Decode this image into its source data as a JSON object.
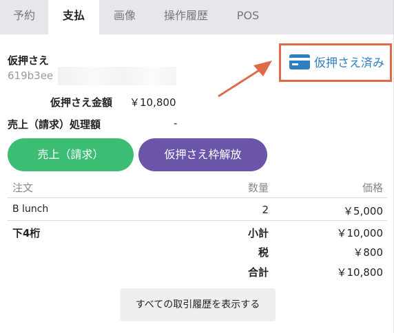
{
  "tabs": [
    {
      "label": "予約",
      "active": false
    },
    {
      "label": "支払",
      "active": true
    },
    {
      "label": "画像",
      "active": false
    },
    {
      "label": "操作履歴",
      "active": false
    },
    {
      "label": "POS",
      "active": false
    }
  ],
  "hold": {
    "title": "仮押さえ",
    "id": "619b3ee"
  },
  "amounts": {
    "hold_amount_label": "仮押さえ金額",
    "hold_amount_value": "￥10,800",
    "sales_processed_label": "売上（請求）処理額",
    "sales_processed_value": "-"
  },
  "callout": {
    "label": "仮押さえ済み",
    "icon": "credit-card-icon",
    "accent_color": "#e06a47",
    "text_color": "#2f80c2"
  },
  "buttons": {
    "sales_label": "売上（請求）",
    "release_label": "仮押さえ枠解放",
    "sales_color": "#3bbd74",
    "release_color": "#6a55a8"
  },
  "table": {
    "headers": {
      "item": "注文",
      "qty": "数量",
      "price": "価格"
    },
    "rows": [
      {
        "item": "B lunch",
        "qty": "2",
        "price": "￥5,000"
      }
    ]
  },
  "summary": {
    "last4_label": "下4桁",
    "subtotal_label": "小計",
    "subtotal_value": "￥10,000",
    "tax_label": "税",
    "tax_value": "￥800",
    "total_label": "合計",
    "total_value": "￥10,800"
  },
  "history_button_label": "すべての取引履歴を表示する"
}
